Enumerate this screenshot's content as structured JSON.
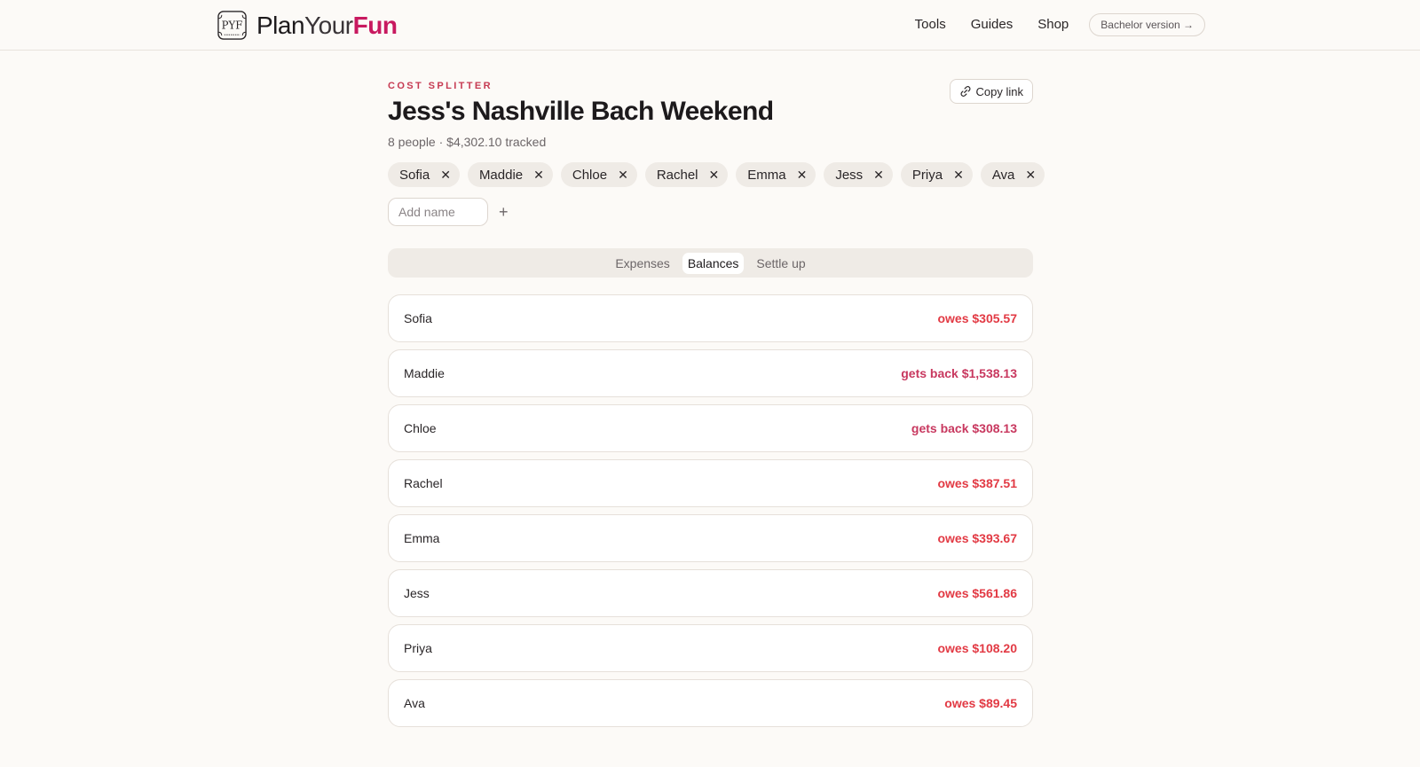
{
  "brand": {
    "part1": "Plan",
    "part2": "Your",
    "part3": "Fun",
    "logo_text": "PYF",
    "accent": "#c8195f"
  },
  "nav": {
    "items": [
      "Tools",
      "Guides",
      "Shop"
    ],
    "bachelor_label": "Bachelor version →"
  },
  "page": {
    "eyebrow": "COST SPLITTER",
    "title": "Jess's Nashville Bach Weekend",
    "meta": "8 people · $4,302.10 tracked",
    "copy_link_label": "Copy link"
  },
  "people": [
    "Sofia",
    "Maddie",
    "Chloe",
    "Rachel",
    "Emma",
    "Jess",
    "Priya",
    "Ava"
  ],
  "add_name": {
    "placeholder": "Add name",
    "plus_label": "+"
  },
  "tabs": [
    {
      "label": "Expenses",
      "active": false
    },
    {
      "label": "Balances",
      "active": true
    },
    {
      "label": "Settle up",
      "active": false
    }
  ],
  "balances": [
    {
      "name": "Sofia",
      "status": "owes",
      "text": "owes $305.57"
    },
    {
      "name": "Maddie",
      "status": "gets",
      "text": "gets back $1,538.13"
    },
    {
      "name": "Chloe",
      "status": "gets",
      "text": "gets back $308.13"
    },
    {
      "name": "Rachel",
      "status": "owes",
      "text": "owes $387.51"
    },
    {
      "name": "Emma",
      "status": "owes",
      "text": "owes $393.67"
    },
    {
      "name": "Jess",
      "status": "owes",
      "text": "owes $561.86"
    },
    {
      "name": "Priya",
      "status": "owes",
      "text": "owes $108.20"
    },
    {
      "name": "Ava",
      "status": "owes",
      "text": "owes $89.45"
    }
  ],
  "colors": {
    "owes": "#e23a44",
    "gets": "#c8385f",
    "eyebrow": "#c63a52",
    "background": "#fcfaf7"
  }
}
